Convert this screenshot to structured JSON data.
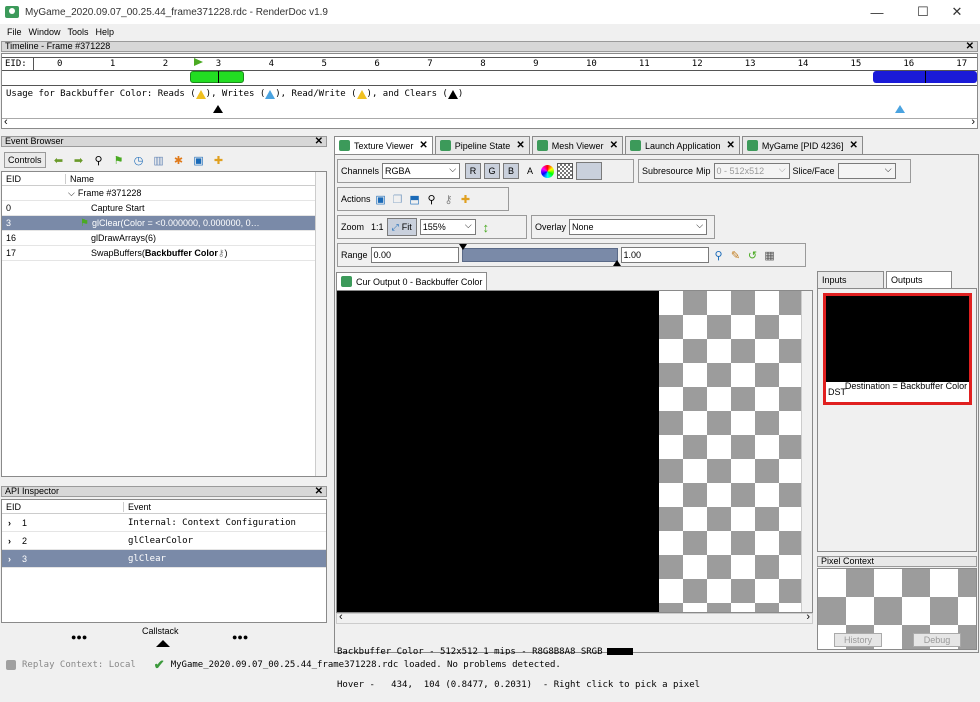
{
  "window": {
    "title": "MyGame_2020.09.07_00.25.44_frame371228.rdc - RenderDoc v1.9",
    "minimize": "—",
    "maximize": "☐",
    "close": "✕"
  },
  "menu": [
    "File",
    "Window",
    "Tools",
    "Help"
  ],
  "timeline": {
    "title": "Timeline - Frame #371228",
    "eid_label": "EID:",
    "ticks": [
      "0",
      "1",
      "2",
      "3",
      "4",
      "5",
      "6",
      "7",
      "8",
      "9",
      "10",
      "11",
      "12",
      "13",
      "14",
      "15",
      "16",
      "17"
    ],
    "usage_text_parts": [
      "Usage for Backbuffer Color: Reads (",
      "), Writes (",
      "), Read/Write (",
      "), and Clears (",
      ")"
    ]
  },
  "event_browser": {
    "title": "Event Browser",
    "controls_label": "Controls",
    "columns": [
      "EID",
      "Name"
    ],
    "rows": [
      {
        "eid": "",
        "name": "Frame #371228"
      },
      {
        "eid": "0",
        "name": "Capture Start"
      },
      {
        "eid": "3",
        "name": "glClear(Color = <0.000000, 0.000000, 0…"
      },
      {
        "eid": "16",
        "name": "glDrawArrays(6)"
      },
      {
        "eid": "17",
        "name": "SwapBuffers(",
        "bold": "Backbuffer Color",
        "tail": ")"
      }
    ]
  },
  "api_inspector": {
    "title": "API Inspector",
    "columns": [
      "EID",
      "Event"
    ],
    "rows": [
      {
        "eid": "1",
        "event": "Internal: Context Configuration"
      },
      {
        "eid": "2",
        "event": "glClearColor"
      },
      {
        "eid": "3",
        "event": "glClear"
      }
    ],
    "callstack": "Callstack",
    "dots": "●●●"
  },
  "tabs": [
    {
      "label": "Texture Viewer"
    },
    {
      "label": "Pipeline State"
    },
    {
      "label": "Mesh Viewer"
    },
    {
      "label": "Launch Application"
    },
    {
      "label": "MyGame [PID 4236]"
    }
  ],
  "texture_viewer": {
    "channels_label": "Channels",
    "channels_value": "RGBA",
    "r": "R",
    "g": "G",
    "b": "B",
    "a": "A",
    "subresource_label": "Subresource",
    "mip_label": "Mip",
    "mip_value": "0 - 512x512",
    "slice_label": "Slice/Face",
    "slice_value": "",
    "actions_label": "Actions",
    "zoom_label": "Zoom",
    "zoom_1to1": "1:1",
    "fit_label": "Fit",
    "zoom_value": "155%",
    "overlay_label": "Overlay",
    "overlay_value": "None",
    "range_label": "Range",
    "range_min": "0.00",
    "range_max": "1.00",
    "output_tab": "Cur Output 0 - Backbuffer Color",
    "status_line1": "Backbuffer Color - 512x512 1 mips - R8G8B8A8_SRGB",
    "status_line2": "Hover -   434,  104 (0.8477, 0.2031)  - Right click to pick a pixel",
    "inputs_tab": "Inputs",
    "outputs_tab": "Outputs",
    "thumb_label": "DST",
    "thumb_caption": "Destination = Backbuffer Color",
    "pixel_context_title": "Pixel Context",
    "history_btn": "History",
    "debug_btn": "Debug"
  },
  "statusbar": {
    "replay": "Replay Context: Local",
    "message": "MyGame_2020.09.07_00.25.44_frame371228.rdc loaded. No problems detected."
  },
  "colors": {
    "accent": "#3c9a5a",
    "selected": "#7a8aa8",
    "clear_marker": "#000000",
    "write_marker": "#4aa3e0",
    "read_marker": "#f0c020",
    "event_green": "#22dd22",
    "event_blue": "#1a1ad8",
    "thumb_border": "#e02020"
  }
}
